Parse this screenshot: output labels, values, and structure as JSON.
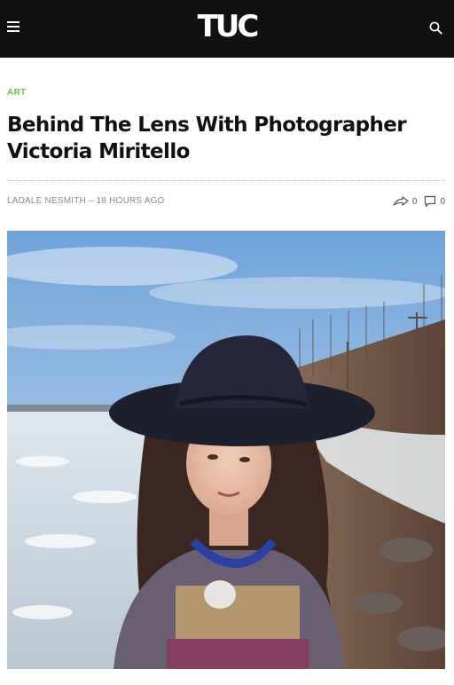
{
  "header": {
    "logo_text": "TUC",
    "menu_icon": "hamburger-menu-icon",
    "search_icon": "search-icon",
    "background": "#111111"
  },
  "article": {
    "category": "ART",
    "category_color": "#6fc34a",
    "title": "Behind The Lens With Photographer Victoria Miritello",
    "author": "LADALE NESMITH",
    "separator": "–",
    "time_ago": "18 HOURS AGO",
    "shares_icon": "share-icon",
    "shares_count": "0",
    "comments_icon": "comment-icon",
    "comments_count": "0"
  },
  "hero_image": {
    "description_icon": "photo"
  }
}
